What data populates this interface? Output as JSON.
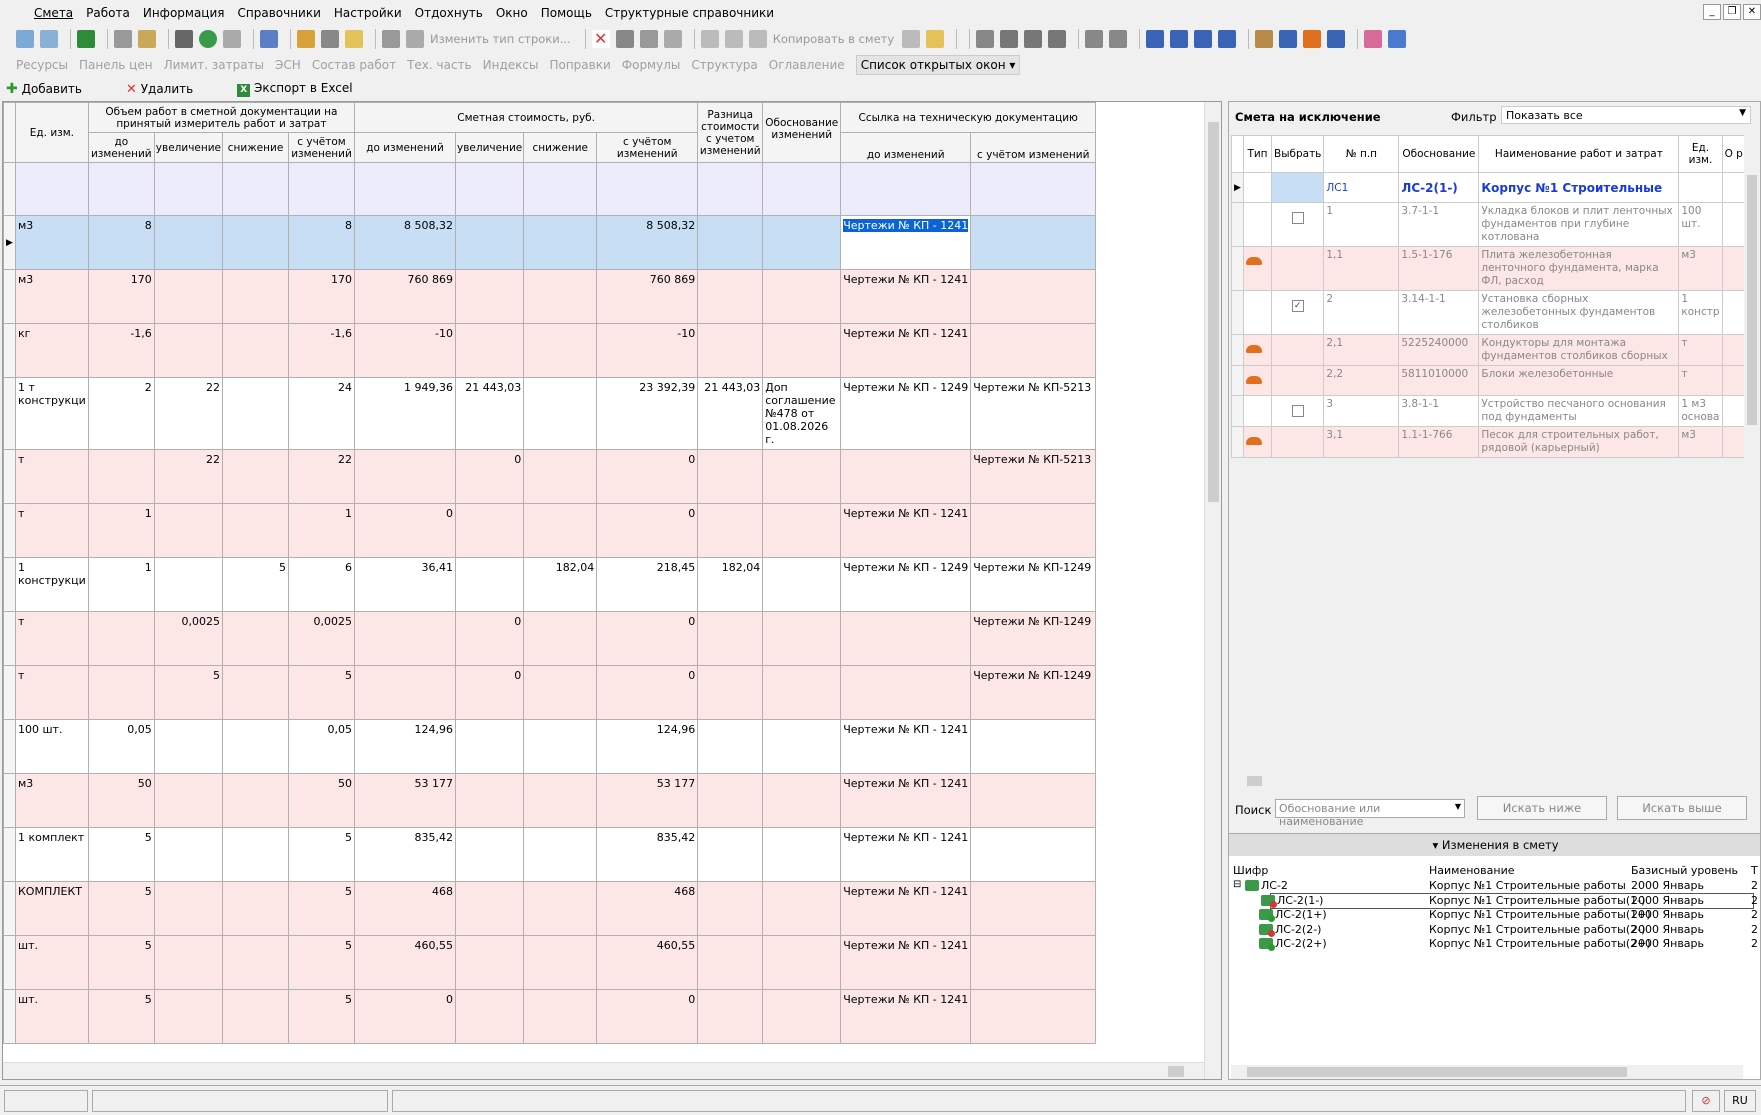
{
  "menu": [
    "Смета",
    "Работа",
    "Информация",
    "Справочники",
    "Настройки",
    "Отдохнуть",
    "Окно",
    "Помощь",
    "Структурные справочники"
  ],
  "toolbar": {
    "change_type": "Изменить тип строки...",
    "copy_to_estimate": "Копировать в смету"
  },
  "nav": {
    "items": [
      "Ресурсы",
      "Панель цен",
      "Лимит. затраты",
      "ЭСН",
      "Состав работ",
      "Тех. часть",
      "Индексы",
      "Поправки",
      "Формулы",
      "Структура",
      "Оглавление"
    ],
    "active": "Список открытых окон"
  },
  "actions": {
    "add": "Добавить",
    "delete": "Удалить",
    "export": "Экспорт в Excel"
  },
  "grid": {
    "headers": {
      "unit": "Ед. изм.",
      "volume_group": "Объем работ в сметной документации на принятый измеритель работ и затрат",
      "cost_group": "Сметная стоимость, руб.",
      "diff": "Разница стоимости с учетом изменений",
      "basis": "Обоснование изменений",
      "link_group": "Ссылка на техническую документацию",
      "before": "до изменений",
      "increase": "увеличение",
      "decrease": "снижение",
      "with_changes": "с учётом изменений",
      "link_before": "до изменений",
      "link_after": "с учётом изменений"
    },
    "rows": [
      {
        "style": "lav",
        "unit": "",
        "v_before": "",
        "v_inc": "",
        "v_dec": "",
        "v_with": "",
        "c_before": "",
        "c_inc": "",
        "c_dec": "",
        "c_with": "",
        "diff": "",
        "basis": "",
        "link_before": "",
        "link_after": ""
      },
      {
        "style": "blue",
        "unit": "м3",
        "v_before": "8",
        "v_inc": "",
        "v_dec": "",
        "v_with": "8",
        "c_before": "8 508,32",
        "c_inc": "",
        "c_dec": "",
        "c_with": "8 508,32",
        "diff": "",
        "basis": "",
        "link_before": "Чертежи № КП - 1241",
        "link_after": ""
      },
      {
        "style": "pink",
        "unit": "м3",
        "v_before": "170",
        "v_inc": "",
        "v_dec": "",
        "v_with": "170",
        "c_before": "760 869",
        "c_inc": "",
        "c_dec": "",
        "c_with": "760 869",
        "diff": "",
        "basis": "",
        "link_before": "Чертежи № КП - 1241",
        "link_after": ""
      },
      {
        "style": "pink",
        "unit": "кг",
        "v_before": "-1,6",
        "v_inc": "",
        "v_dec": "",
        "v_with": "-1,6",
        "c_before": "-10",
        "c_inc": "",
        "c_dec": "",
        "c_with": "-10",
        "diff": "",
        "basis": "",
        "link_before": "Чертежи № КП - 1241",
        "link_after": ""
      },
      {
        "style": "white",
        "unit": "1 т конструкци",
        "v_before": "2",
        "v_inc": "22",
        "v_dec": "",
        "v_with": "24",
        "c_before": "1 949,36",
        "c_inc": "21 443,03",
        "c_dec": "",
        "c_with": "23 392,39",
        "diff": "21 443,03",
        "basis": "Доп соглашение №478 от 01.08.2026 г.",
        "link_before": "Чертежи № КП - 1249",
        "link_after": "Чертежи № КП-5213"
      },
      {
        "style": "pink",
        "unit": "т",
        "v_before": "",
        "v_inc": "22",
        "v_dec": "",
        "v_with": "22",
        "c_before": "",
        "c_inc": "0",
        "c_dec": "",
        "c_with": "0",
        "diff": "",
        "basis": "",
        "link_before": "",
        "link_after": "Чертежи № КП-5213"
      },
      {
        "style": "pink",
        "unit": "т",
        "v_before": "1",
        "v_inc": "",
        "v_dec": "",
        "v_with": "1",
        "c_before": "0",
        "c_inc": "",
        "c_dec": "",
        "c_with": "0",
        "diff": "",
        "basis": "",
        "link_before": "Чертежи № КП - 1241",
        "link_after": ""
      },
      {
        "style": "white",
        "unit": "1 конструкци",
        "v_before": "1",
        "v_inc": "",
        "v_dec": "5",
        "v_with": "6",
        "c_before": "36,41",
        "c_inc": "",
        "c_dec": "182,04",
        "c_with": "218,45",
        "diff": "182,04",
        "basis": "",
        "link_before": "Чертежи № КП - 1249",
        "link_after": "Чертежи № КП-1249"
      },
      {
        "style": "pink",
        "unit": "т",
        "v_before": "",
        "v_inc": "0,0025",
        "v_dec": "",
        "v_with": "0,0025",
        "c_before": "",
        "c_inc": "0",
        "c_dec": "",
        "c_with": "0",
        "diff": "",
        "basis": "",
        "link_before": "",
        "link_after": "Чертежи № КП-1249"
      },
      {
        "style": "pink",
        "unit": "т",
        "v_before": "",
        "v_inc": "5",
        "v_dec": "",
        "v_with": "5",
        "c_before": "",
        "c_inc": "0",
        "c_dec": "",
        "c_with": "0",
        "diff": "",
        "basis": "",
        "link_before": "",
        "link_after": "Чертежи № КП-1249"
      },
      {
        "style": "white",
        "unit": "100 шт.",
        "v_before": "0,05",
        "v_inc": "",
        "v_dec": "",
        "v_with": "0,05",
        "c_before": "124,96",
        "c_inc": "",
        "c_dec": "",
        "c_with": "124,96",
        "diff": "",
        "basis": "",
        "link_before": "Чертежи № КП - 1241",
        "link_after": ""
      },
      {
        "style": "pink",
        "unit": "м3",
        "v_before": "50",
        "v_inc": "",
        "v_dec": "",
        "v_with": "50",
        "c_before": "53 177",
        "c_inc": "",
        "c_dec": "",
        "c_with": "53 177",
        "diff": "",
        "basis": "",
        "link_before": "Чертежи № КП - 1241",
        "link_after": ""
      },
      {
        "style": "white",
        "unit": "1 комплект",
        "v_before": "5",
        "v_inc": "",
        "v_dec": "",
        "v_with": "5",
        "c_before": "835,42",
        "c_inc": "",
        "c_dec": "",
        "c_with": "835,42",
        "diff": "",
        "basis": "",
        "link_before": "Чертежи № КП - 1241",
        "link_after": ""
      },
      {
        "style": "pink",
        "unit": "КОМПЛЕКТ",
        "v_before": "5",
        "v_inc": "",
        "v_dec": "",
        "v_with": "5",
        "c_before": "468",
        "c_inc": "",
        "c_dec": "",
        "c_with": "468",
        "diff": "",
        "basis": "",
        "link_before": "Чертежи № КП - 1241",
        "link_after": ""
      },
      {
        "style": "pink",
        "unit": "шт.",
        "v_before": "5",
        "v_inc": "",
        "v_dec": "",
        "v_with": "5",
        "c_before": "460,55",
        "c_inc": "",
        "c_dec": "",
        "c_with": "460,55",
        "diff": "",
        "basis": "",
        "link_before": "Чертежи № КП - 1241",
        "link_after": ""
      },
      {
        "style": "pink",
        "unit": "шт.",
        "v_before": "5",
        "v_inc": "",
        "v_dec": "",
        "v_with": "5",
        "c_before": "0",
        "c_inc": "",
        "c_dec": "",
        "c_with": "0",
        "diff": "",
        "basis": "",
        "link_before": "Чертежи № КП - 1241",
        "link_after": ""
      }
    ]
  },
  "right": {
    "title": "Смета на исключение",
    "filter_label": "Фильтр",
    "filter_value": "Показать все",
    "headers": {
      "type": "Тип",
      "select": "Выбрать",
      "num": "№ п.п",
      "basis": "Обоснование",
      "name": "Наименование работ и затрат",
      "unit": "Ед. изм.",
      "extra": "О р"
    },
    "top": {
      "num": "ЛС1",
      "basis": "ЛС-2(1-)",
      "name": "Корпус №1 Строительные"
    },
    "rows": [
      {
        "bg": "white",
        "icon": false,
        "check": "empty",
        "num": "1",
        "basis": "3.7-1-1",
        "name": "Укладка блоков и плит ленточных фундаментов при глубине котлована",
        "unit": "100 шт."
      },
      {
        "bg": "pink",
        "icon": true,
        "check": "none",
        "num": "1,1",
        "basis": "1.5-1-176",
        "name": "Плита железобетонная ленточного фундамента, марка ФЛ, расход",
        "unit": "м3"
      },
      {
        "bg": "white",
        "icon": false,
        "check": "checked",
        "num": "2",
        "basis": "3.14-1-1",
        "name": "Установка сборных железобетонных фундаментов столбиков",
        "unit": "1 констр"
      },
      {
        "bg": "pink",
        "icon": true,
        "check": "none",
        "num": "2,1",
        "basis": "5225240000",
        "name": "Кондукторы для монтажа фундаментов столбиков сборных",
        "unit": "т"
      },
      {
        "bg": "pink",
        "icon": true,
        "check": "none",
        "num": "2,2",
        "basis": "5811010000",
        "name": "Блоки железобетонные",
        "unit": "т"
      },
      {
        "bg": "white",
        "icon": false,
        "check": "empty",
        "num": "3",
        "basis": "3.8-1-1",
        "name": "Устройство песчаного основания под фундаменты",
        "unit": "1 м3 основа"
      },
      {
        "bg": "pink",
        "icon": true,
        "check": "none",
        "num": "3,1",
        "basis": "1.1-1-766",
        "name": "Песок для строительных работ, рядовой (карьерный)",
        "unit": "м3"
      }
    ],
    "search_label": "Поиск",
    "search_placeholder": "Обоснование или наименование",
    "search_down": "Искать ниже",
    "search_up": "Искать выше"
  },
  "changes": {
    "title": "Изменения в смету",
    "headers": {
      "code": "Шифр",
      "name": "Наименование",
      "level": "Базисный уровень",
      "extra": "Т"
    },
    "rows": [
      {
        "code": "ЛС-2",
        "name": "Корпус №1 Строительные работы",
        "level": "2000 Январь",
        "extra": "2"
      },
      {
        "code": "ЛС-2(1-)",
        "name": "Корпус №1 Строительные работы(1-)",
        "level": "2000 Январь",
        "extra": "2"
      },
      {
        "code": "ЛС-2(1+)",
        "name": "Корпус №1 Строительные работы(1+)",
        "level": "2000 Январь",
        "extra": "2"
      },
      {
        "code": "ЛС-2(2-)",
        "name": "Корпус №1 Строительные работы(2-)",
        "level": "2000 Январь",
        "extra": "2"
      },
      {
        "code": "ЛС-2(2+)",
        "name": "Корпус №1 Строительные работы(2+)",
        "level": "2000 Январь",
        "extra": "2"
      }
    ]
  },
  "status": {
    "lang": "RU"
  },
  "colors": {
    "pink": "#fde6e6",
    "blue": "#c8def5",
    "lavender": "#ececfc",
    "accent": "#1a3bd6"
  }
}
